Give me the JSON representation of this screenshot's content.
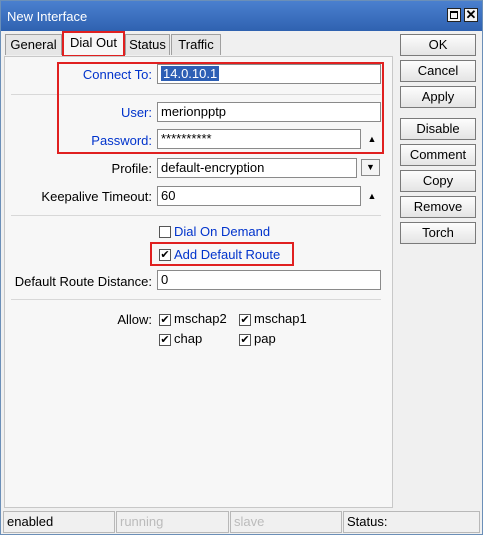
{
  "window": {
    "title": "New Interface"
  },
  "tabs": [
    {
      "label": "General"
    },
    {
      "label": "Dial Out"
    },
    {
      "label": "Status"
    },
    {
      "label": "Traffic"
    }
  ],
  "form": {
    "connect_to": {
      "label": "Connect To:",
      "value": "14.0.10.1"
    },
    "user": {
      "label": "User:",
      "value": "merionpptp"
    },
    "password": {
      "label": "Password:",
      "value": "**********"
    },
    "profile": {
      "label": "Profile:",
      "value": "default-encryption"
    },
    "keepalive": {
      "label": "Keepalive Timeout:",
      "value": "60"
    },
    "dial_on_demand": {
      "label": "Dial On Demand",
      "checked": false
    },
    "add_default_route": {
      "label": "Add Default Route",
      "checked": true
    },
    "default_route_distance": {
      "label": "Default Route Distance:",
      "value": "0"
    },
    "allow": {
      "label": "Allow:",
      "options": [
        {
          "label": "mschap2",
          "checked": true
        },
        {
          "label": "mschap1",
          "checked": true
        },
        {
          "label": "chap",
          "checked": true
        },
        {
          "label": "pap",
          "checked": true
        }
      ]
    }
  },
  "buttons": {
    "ok": "OK",
    "cancel": "Cancel",
    "apply": "Apply",
    "disable": "Disable",
    "comment": "Comment",
    "copy": "Copy",
    "remove": "Remove",
    "torch": "Torch"
  },
  "statusbar": {
    "state": "enabled",
    "running": "running",
    "slave": "slave",
    "status": "Status:"
  },
  "glyphs": {
    "check": "✔",
    "up": "▲",
    "down": "▼",
    "close": "✕"
  },
  "colors": {
    "highlight": "#e02020",
    "title_bar": "#3a6fbd",
    "label_blue": "#0033cc"
  }
}
